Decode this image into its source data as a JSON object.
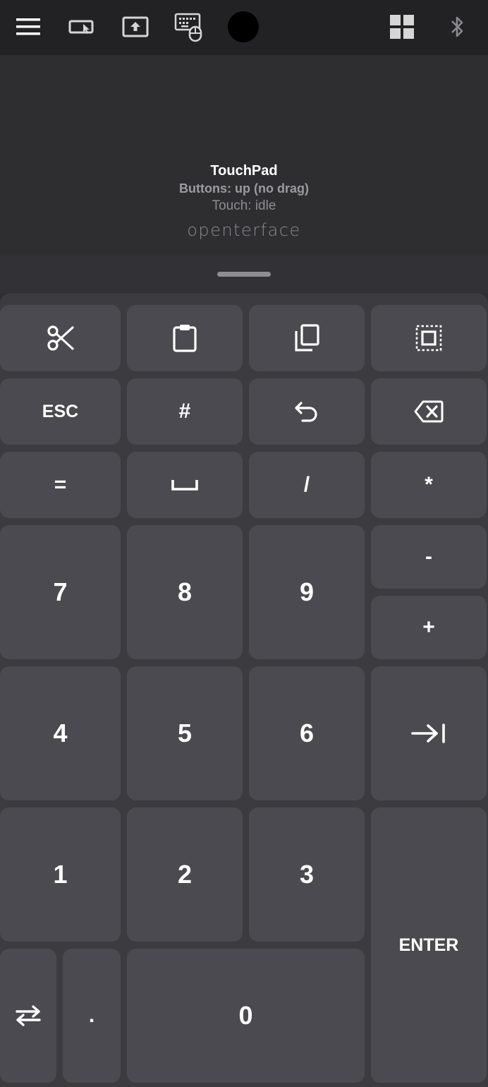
{
  "toolbar": {
    "icons": [
      "menu-icon",
      "screen-mouse-icon",
      "upload-screen-icon",
      "keyboard-mouse-icon",
      "record-dot-icon",
      "grid-icon",
      "bluetooth-icon"
    ]
  },
  "touchpad": {
    "title": "TouchPad",
    "buttons_status": "Buttons: up (no drag)",
    "touch_status": "Touch: idle",
    "logo": "openterface"
  },
  "keypad": {
    "esc": "ESC",
    "hash": "#",
    "equals": "=",
    "slash": "/",
    "asterisk": "*",
    "minus": "-",
    "plus": "+",
    "k7": "7",
    "k8": "8",
    "k9": "9",
    "k4": "4",
    "k5": "5",
    "k6": "6",
    "k1": "1",
    "k2": "2",
    "k3": "3",
    "k0": "0",
    "dot": ".",
    "enter": "ENTER"
  },
  "colors": {
    "toolbar_bg": "#222224",
    "touchpad_bg": "#2e2e31",
    "keypad_bg": "#3b3b40",
    "key_bg": "#4a4a50",
    "text": "#ffffff"
  }
}
